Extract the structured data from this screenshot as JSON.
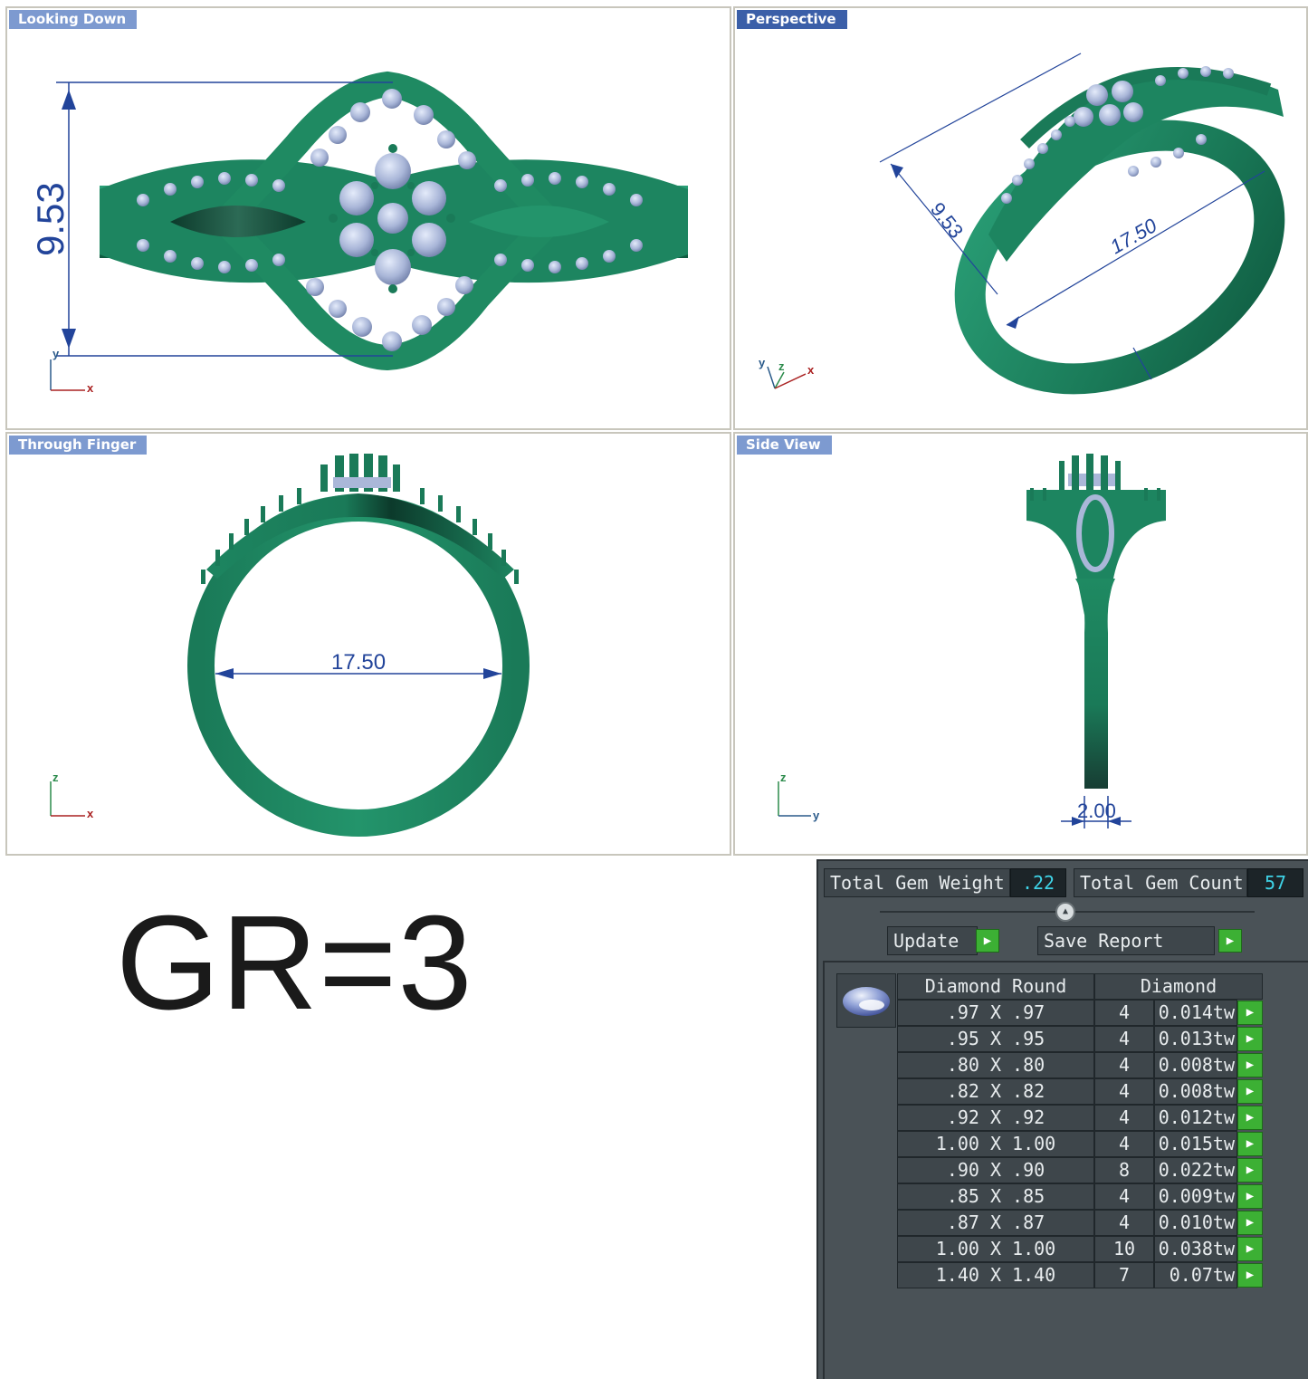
{
  "viewports": {
    "top": {
      "label": "Looking Down",
      "dimension": "9.53",
      "axes": [
        "y",
        "x"
      ]
    },
    "perspective": {
      "label": "Perspective",
      "dimension_a": "9.53",
      "dimension_b": "17.50",
      "axes": [
        "y",
        "z",
        "x"
      ]
    },
    "front": {
      "label": "Through Finger",
      "dimension": "17.50",
      "axes": [
        "z",
        "x"
      ]
    },
    "side": {
      "label": "Side View",
      "dimension": "2.00",
      "axes": [
        "z",
        "y"
      ]
    }
  },
  "grade": "GR=3",
  "report": {
    "total_weight_label": "Total Gem Weight",
    "total_weight_value": ".22",
    "total_count_label": "Total Gem Count",
    "total_count_value": "57",
    "update_label": "Update",
    "save_label": "Save Report",
    "columns": [
      "Diamond Round",
      "Diamond"
    ],
    "rows": [
      {
        "size": ".97 X .97",
        "count": "4",
        "weight": "0.014tw"
      },
      {
        "size": ".95 X .95",
        "count": "4",
        "weight": "0.013tw"
      },
      {
        "size": ".80 X .80",
        "count": "4",
        "weight": "0.008tw"
      },
      {
        "size": ".82 X .82",
        "count": "4",
        "weight": "0.008tw"
      },
      {
        "size": ".92 X .92",
        "count": "4",
        "weight": "0.012tw"
      },
      {
        "size": "1.00 X 1.00",
        "count": "4",
        "weight": "0.015tw"
      },
      {
        "size": ".90 X .90",
        "count": "8",
        "weight": "0.022tw"
      },
      {
        "size": ".85 X .85",
        "count": "4",
        "weight": "0.009tw"
      },
      {
        "size": ".87 X .87",
        "count": "4",
        "weight": "0.010tw"
      },
      {
        "size": "1.00 X 1.00",
        "count": "10",
        "weight": "0.038tw"
      },
      {
        "size": "1.40 X 1.40",
        "count": "7",
        "weight": "0.07tw"
      }
    ]
  },
  "colors": {
    "metal": "#1f8a62",
    "metal_dark": "#0f4f3a",
    "gem": "#aab7d8",
    "dimension": "#22449a",
    "panel_bg": "#4a5257",
    "value_text": "#3fd4e8",
    "arrow_green": "#3cb034"
  },
  "icons": {
    "play_arrow": "play-icon",
    "collapse": "chevron-up-icon",
    "gem_thumbnail": "round-diamond-icon"
  }
}
